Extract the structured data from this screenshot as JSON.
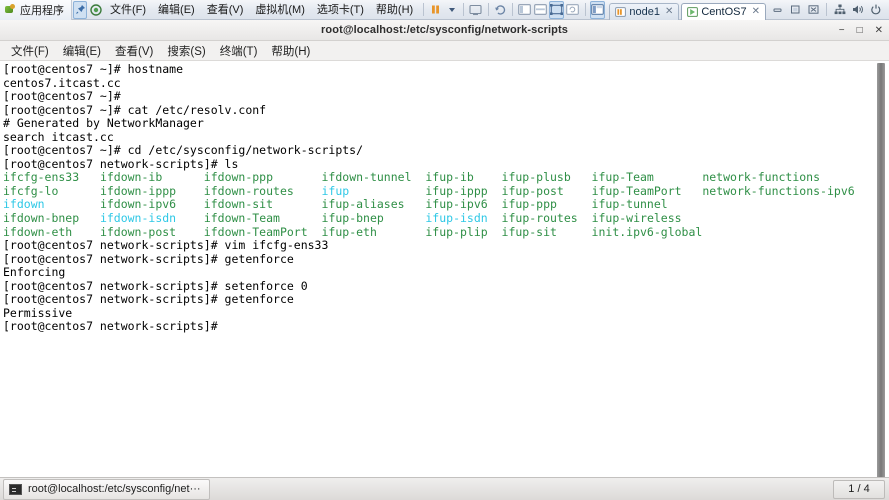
{
  "vmware": {
    "apps_label": "应用程序",
    "menus": [
      "文件(F)",
      "编辑(E)",
      "查看(V)",
      "虚拟机(M)",
      "选项卡(T)",
      "帮助(H)"
    ],
    "toolbar_icons": [
      "pin-icon",
      "snapshot-icon",
      "pause-icon",
      "dropdown-caret-icon",
      "send-ctrl-alt-del-icon",
      "revert-snapshot-icon",
      "split-view-icon",
      "unity-view-icon",
      "fullscreen-icon",
      "refresh-icon",
      "library-icon"
    ],
    "tabs": [
      {
        "label": "node1",
        "icon": "vm-powered-icon",
        "active": false,
        "close": "✕"
      },
      {
        "label": "CentOS7",
        "icon": "vm-suspended-icon",
        "active": true,
        "close": "✕"
      }
    ],
    "window_buttons": [
      "minimize-icon",
      "restore-icon",
      "close-icon"
    ],
    "tray_icons": [
      "network-icon",
      "volume-icon",
      "power-icon"
    ]
  },
  "terminal": {
    "title": "root@localhost:/etc/sysconfig/network-scripts",
    "window_buttons": {
      "minimize": "−",
      "maximize": "□",
      "close": "✕"
    },
    "menus": [
      "文件(F)",
      "编辑(E)",
      "查看(V)",
      "搜索(S)",
      "终端(T)",
      "帮助(H)"
    ],
    "lines": [
      [
        {
          "t": "[root@centos7 ~]# hostname",
          "c": "k"
        }
      ],
      [
        {
          "t": "centos7.itcast.cc",
          "c": "k"
        }
      ],
      [
        {
          "t": "[root@centos7 ~]#",
          "c": "k"
        }
      ],
      [
        {
          "t": "[root@centos7 ~]# cat /etc/resolv.conf",
          "c": "k"
        }
      ],
      [
        {
          "t": "# Generated by NetworkManager",
          "c": "k"
        }
      ],
      [
        {
          "t": "search itcast.cc",
          "c": "k"
        }
      ],
      [
        {
          "t": "[root@centos7 ~]# cd /etc/sysconfig/network-scripts/",
          "c": "k"
        }
      ],
      [
        {
          "t": "[root@centos7 network-scripts]# ls",
          "c": "k"
        }
      ],
      [
        {
          "t": "ifcfg-ens33   ",
          "c": "g"
        },
        {
          "t": "ifdown-ib      ",
          "c": "g"
        },
        {
          "t": "ifdown-ppp       ",
          "c": "g"
        },
        {
          "t": "ifdown-tunnel  ",
          "c": "g"
        },
        {
          "t": "ifup-ib    ",
          "c": "g"
        },
        {
          "t": "ifup-plusb   ",
          "c": "g"
        },
        {
          "t": "ifup-Team       ",
          "c": "g"
        },
        {
          "t": "network-functions",
          "c": "g"
        }
      ],
      [
        {
          "t": "ifcfg-lo      ",
          "c": "g"
        },
        {
          "t": "ifdown-ippp    ",
          "c": "g"
        },
        {
          "t": "ifdown-routes    ",
          "c": "g"
        },
        {
          "t": "ifup",
          "c": "c"
        },
        {
          "t": "           ",
          "c": "g"
        },
        {
          "t": "ifup-ippp  ",
          "c": "g"
        },
        {
          "t": "ifup-post    ",
          "c": "g"
        },
        {
          "t": "ifup-TeamPort   ",
          "c": "g"
        },
        {
          "t": "network-functions-ipv6",
          "c": "g"
        }
      ],
      [
        {
          "t": "ifdown",
          "c": "c"
        },
        {
          "t": "        ",
          "c": "g"
        },
        {
          "t": "ifdown-ipv6    ",
          "c": "g"
        },
        {
          "t": "ifdown-sit       ",
          "c": "g"
        },
        {
          "t": "ifup-aliases   ",
          "c": "g"
        },
        {
          "t": "ifup-ipv6  ",
          "c": "g"
        },
        {
          "t": "ifup-ppp     ",
          "c": "g"
        },
        {
          "t": "ifup-tunnel",
          "c": "g"
        }
      ],
      [
        {
          "t": "ifdown-bnep   ",
          "c": "g"
        },
        {
          "t": "ifdown-isdn",
          "c": "c"
        },
        {
          "t": "    ",
          "c": "g"
        },
        {
          "t": "ifdown-Team      ",
          "c": "g"
        },
        {
          "t": "ifup-bnep      ",
          "c": "g"
        },
        {
          "t": "ifup-isdn",
          "c": "c"
        },
        {
          "t": "  ",
          "c": "g"
        },
        {
          "t": "ifup-routes  ",
          "c": "g"
        },
        {
          "t": "ifup-wireless",
          "c": "g"
        }
      ],
      [
        {
          "t": "ifdown-eth    ",
          "c": "g"
        },
        {
          "t": "ifdown-post    ",
          "c": "g"
        },
        {
          "t": "ifdown-TeamPort  ",
          "c": "g"
        },
        {
          "t": "ifup-eth       ",
          "c": "g"
        },
        {
          "t": "ifup-plip  ",
          "c": "g"
        },
        {
          "t": "ifup-sit     ",
          "c": "g"
        },
        {
          "t": "init.ipv6-global",
          "c": "g"
        }
      ],
      [
        {
          "t": "[root@centos7 network-scripts]# vim ifcfg-ens33",
          "c": "k"
        }
      ],
      [
        {
          "t": "[root@centos7 network-scripts]# getenforce",
          "c": "k"
        }
      ],
      [
        {
          "t": "Enforcing",
          "c": "k"
        }
      ],
      [
        {
          "t": "[root@centos7 network-scripts]# setenforce 0",
          "c": "k"
        }
      ],
      [
        {
          "t": "[root@centos7 network-scripts]# getenforce",
          "c": "k"
        }
      ],
      [
        {
          "t": "Permissive",
          "c": "k"
        }
      ],
      [
        {
          "t": "[root@centos7 network-scripts]#",
          "c": "k"
        }
      ]
    ]
  },
  "taskbar": {
    "window_label": "root@localhost:/etc/sysconfig/net···",
    "workspace": "1 / 4"
  },
  "colors": {
    "terminal_bg": "#ffffff",
    "text_black": "#000000",
    "file_green": "#2f8f46",
    "symlink_cyan": "#2ec8e6",
    "chrome_blue": "#dde3ec",
    "pause_orange": "#e8952a"
  }
}
